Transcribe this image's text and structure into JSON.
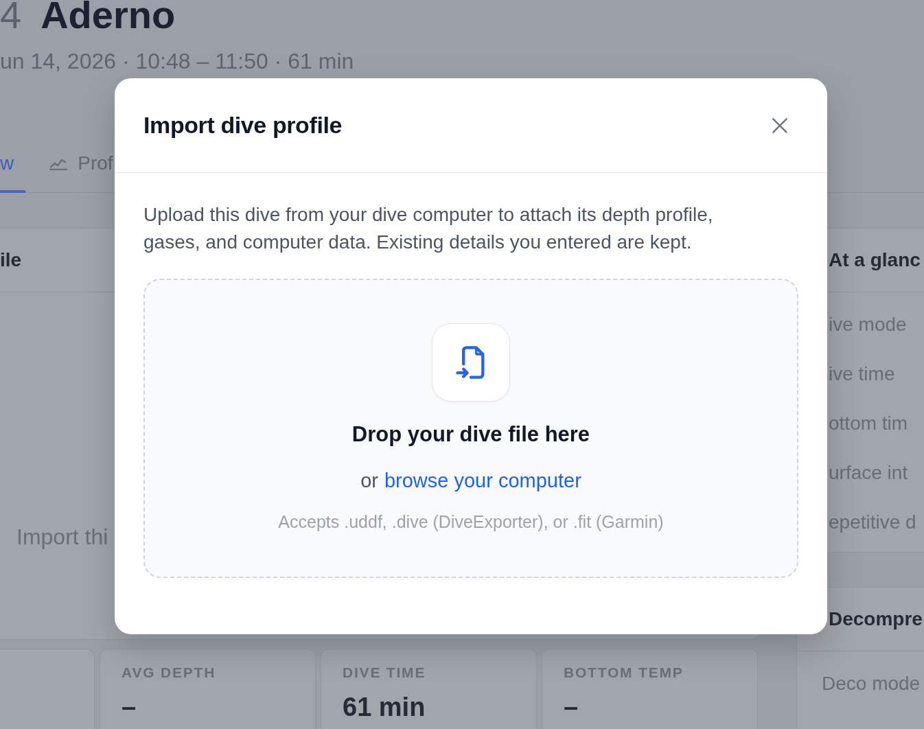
{
  "page": {
    "heading": {
      "number": "4",
      "title": "Aderno"
    },
    "meta": "un 14, 2026 · 10:48 – 11:50 · 61 min",
    "tabs": [
      {
        "label": "w",
        "kind": "text",
        "selected": true
      },
      {
        "label": "Prof",
        "kind": "icon",
        "selected": false
      }
    ],
    "profile_card": {
      "title": "ile",
      "empty_text": "Import thi"
    },
    "stats": [
      {
        "label": "AVG DEPTH",
        "value": "–"
      },
      {
        "label": "DIVE TIME",
        "value": "61 min"
      },
      {
        "label": "BOTTOM TEMP",
        "value": "–"
      }
    ],
    "glance_card": {
      "title": "At a glanc",
      "rows": [
        "ive mode",
        "ive time",
        "ottom tim",
        "urface int",
        "epetitive d"
      ]
    },
    "decompression_card": {
      "title": "Decompre",
      "rows": [
        "Deco mode"
      ]
    }
  },
  "dialog": {
    "title": "Import dive profile",
    "description": "Upload this dive from your dive computer to attach its depth profile, gases, and computer data. Existing details you entered are kept.",
    "dropzone": {
      "heading": "Drop your dive file here",
      "prompt": "or",
      "link": "browse your computer",
      "hint": "Accepts .uddf, .dive (DiveExporter), or .fit (Garmin)"
    }
  }
}
